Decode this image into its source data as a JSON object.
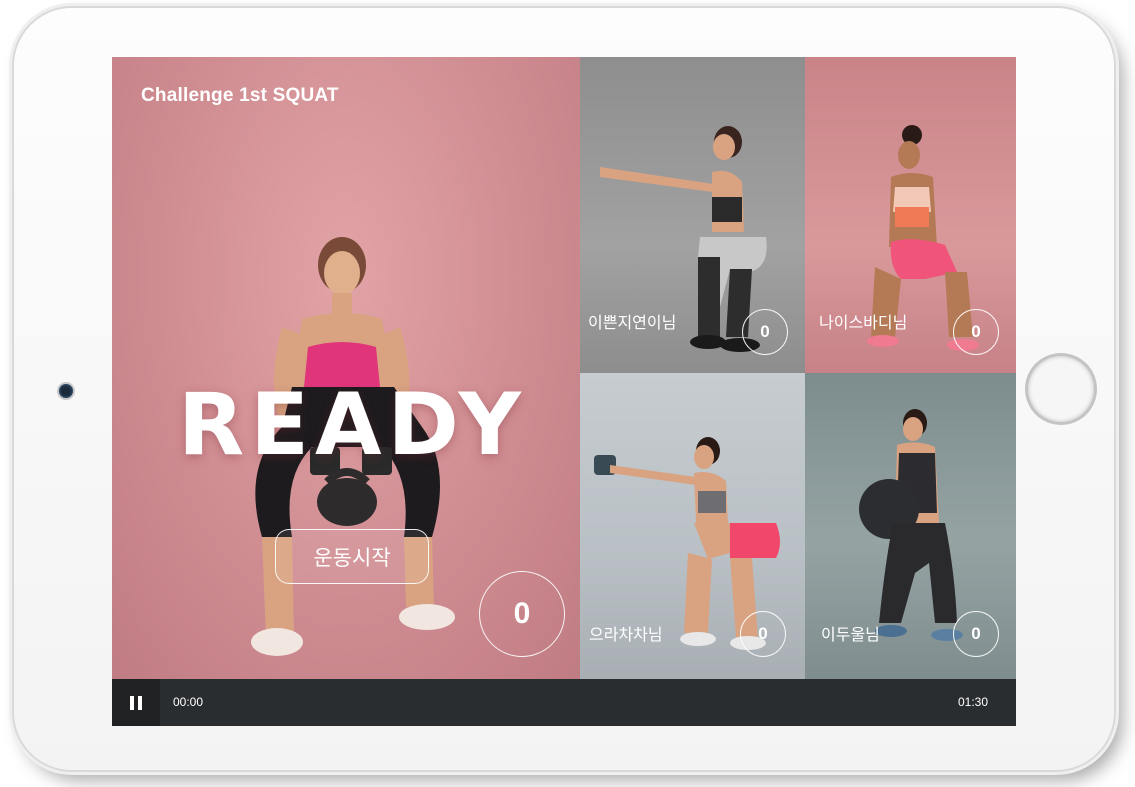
{
  "challenge": {
    "title": "Challenge 1st SQUAT"
  },
  "main": {
    "status_text": "READY",
    "start_button_label": "운동시작",
    "count": "0"
  },
  "participants": [
    {
      "name": "이쁜지연이님",
      "count": "0"
    },
    {
      "name": "나이스바디님",
      "count": "0"
    },
    {
      "name": "으라차차님",
      "count": "0"
    },
    {
      "name": "이두울님",
      "count": "0"
    }
  ],
  "player": {
    "pause_icon": "pause-icon",
    "elapsed_time": "00:00",
    "total_time": "01:30"
  },
  "colors": {
    "main_bg": "#cf8d92",
    "bar_bg": "#2a2d30"
  }
}
